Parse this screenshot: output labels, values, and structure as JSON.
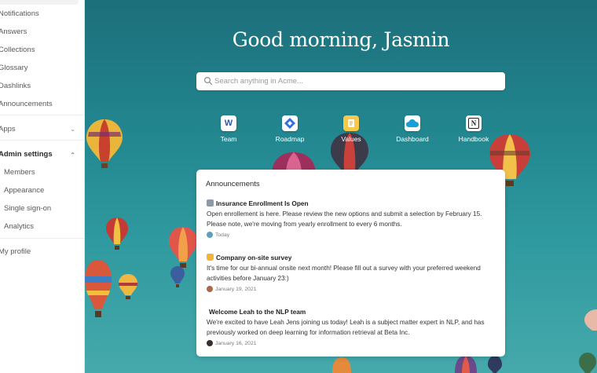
{
  "sidebar": {
    "items": [
      {
        "label": "Notifications"
      },
      {
        "label": "Answers"
      },
      {
        "label": "Collections"
      },
      {
        "label": "Glossary"
      },
      {
        "label": "Dashlinks"
      },
      {
        "label": "Announcements"
      }
    ],
    "apps_label": "Apps",
    "admin_label": "Admin settings",
    "admin_items": [
      {
        "label": "Members"
      },
      {
        "label": "Appearance"
      },
      {
        "label": "Single sign-on"
      },
      {
        "label": "Analytics"
      }
    ],
    "profile_label": "My profile"
  },
  "main": {
    "greeting": "Good morning, Jasmin",
    "search_placeholder": "Search anything in Acme...",
    "shortcuts": [
      {
        "label": "Team",
        "icon": "word-w-icon",
        "color": "#2b5aa8"
      },
      {
        "label": "Roadmap",
        "icon": "jira-diamond-icon",
        "color": "#2f6fe0"
      },
      {
        "label": "Values",
        "icon": "document-icon",
        "color": "#f2b62e"
      },
      {
        "label": "Dashboard",
        "icon": "salesforce-cloud-icon",
        "color": "#16a0db"
      },
      {
        "label": "Handbook",
        "icon": "notion-n-icon",
        "color": "#222222"
      }
    ],
    "announcements": {
      "title": "Announcements",
      "items": [
        {
          "title": "Insurance Enrollment Is Open",
          "body": "Open enrollement is here. Please review the new options and submit a selection by February 15. Please note, we're moving from yearly enrollment to every 6 months.",
          "date": "Today",
          "emoji": "building-emoji-icon"
        },
        {
          "title": "Company on-site survey",
          "body": "It's time for our bi-annual onsite next month! Please fill out a survey with your preferred weekend activities before January 23:)",
          "date": "January 19, 2021",
          "emoji": "beer-emoji-icon"
        },
        {
          "title": "Welcome Leah to the NLP team",
          "body": "We're excited to have Leah Jens joining us today! Leah is a subject matter expert in NLP, and has previously worked on deep learning for information retrieval at Beta Inc.",
          "date": "January 16, 2021",
          "emoji": ""
        }
      ]
    }
  }
}
